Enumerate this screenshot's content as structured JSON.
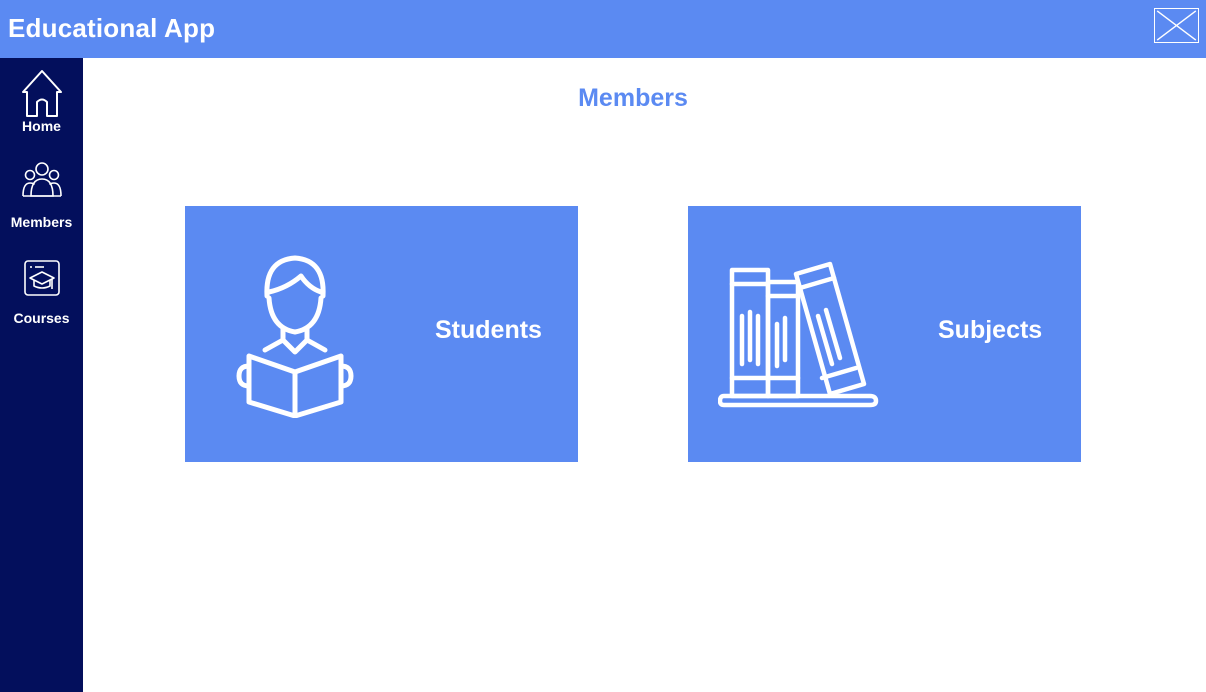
{
  "window": {
    "title": "Educational App",
    "close_icon": "close-icon"
  },
  "sidebar": {
    "items": [
      {
        "label": "Home",
        "icon": "home-icon"
      },
      {
        "label": "Members",
        "icon": "members-icon"
      },
      {
        "label": "Courses",
        "icon": "courses-icon"
      }
    ]
  },
  "main": {
    "title": "Members",
    "cards": [
      {
        "label": "Students",
        "icon": "student-reading-icon"
      },
      {
        "label": "Subjects",
        "icon": "books-icon"
      }
    ]
  },
  "colors": {
    "accent": "#5b8af2",
    "sidebar": "#030f5c",
    "background": "#ffffff",
    "text_on_accent": "#ffffff"
  }
}
